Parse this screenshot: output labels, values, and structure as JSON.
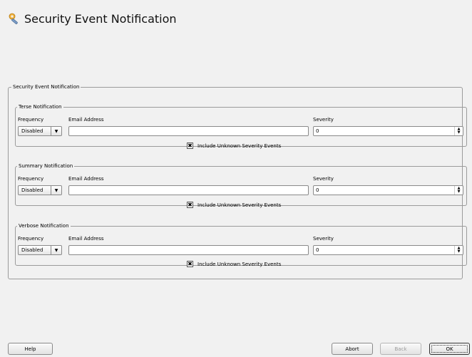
{
  "header": {
    "title": "Security Event Notification",
    "icon": "wrench-tools-icon"
  },
  "outer_legend": "Security Event Notification",
  "groups": [
    {
      "legend": "Terse Notification",
      "frequency_label": "Frequency",
      "email_label": "Email Address",
      "severity_label": "Severity",
      "frequency_value": "Disabled",
      "email_value": "",
      "severity_value": "0",
      "checkbox_label": "Include Unknown Severity Events",
      "checkbox_checked": true
    },
    {
      "legend": "Summary Notification",
      "frequency_label": "Frequency",
      "email_label": "Email Address",
      "severity_label": "Severity",
      "frequency_value": "Disabled",
      "email_value": "",
      "severity_value": "0",
      "checkbox_label": "Include Unknown Severity Events",
      "checkbox_checked": true
    },
    {
      "legend": "Verbose Notification",
      "frequency_label": "Frequency",
      "email_label": "Email Address",
      "severity_label": "Severity",
      "frequency_value": "Disabled",
      "email_value": "",
      "severity_value": "0",
      "checkbox_label": "Include Unknown Severity Events",
      "checkbox_checked": true
    }
  ],
  "buttons": {
    "help": "Help",
    "abort": "Abort",
    "back": "Back",
    "ok": "OK"
  }
}
